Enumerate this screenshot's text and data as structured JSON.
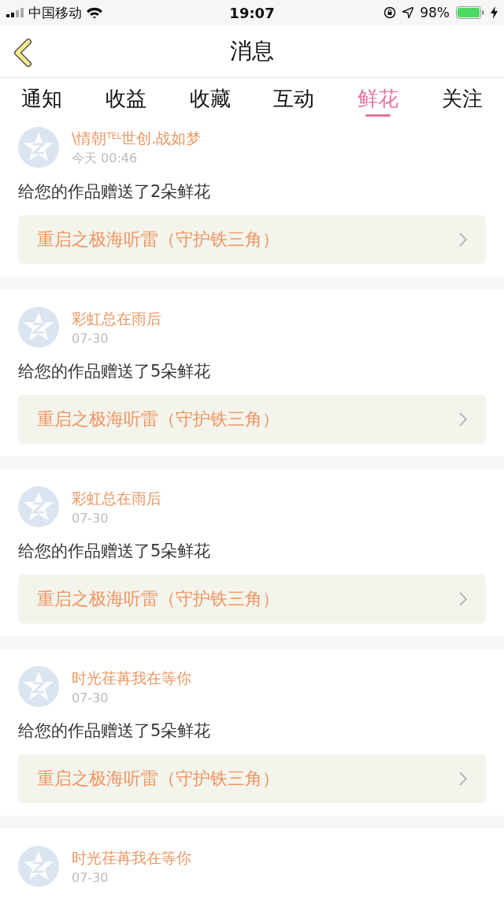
{
  "status_bar": {
    "carrier": "中国移动",
    "time": "19:07",
    "battery": "98%"
  },
  "header": {
    "title": "消息"
  },
  "tabs": [
    {
      "label": "通知",
      "selected": false
    },
    {
      "label": "收益",
      "selected": false
    },
    {
      "label": "收藏",
      "selected": false
    },
    {
      "label": "互动",
      "selected": false
    },
    {
      "label": "鲜花",
      "selected": true
    },
    {
      "label": "关注",
      "selected": false
    }
  ],
  "messages": [
    {
      "name": "\\情朝$^{TEL}$世创.战如梦",
      "time": "今天 00:46",
      "text": "给您的作品赠送了2朵鲜花",
      "work": "重启之极海听雷（守护铁三角）"
    },
    {
      "name": "彩虹总在雨后",
      "time": "07-30",
      "text": "给您的作品赠送了5朵鲜花",
      "work": "重启之极海听雷（守护铁三角）"
    },
    {
      "name": "彩虹总在雨后",
      "time": "07-30",
      "text": "给您的作品赠送了5朵鲜花",
      "work": "重启之极海听雷（守护铁三角）"
    },
    {
      "name": "时光荏苒我在等你",
      "time": "07-30",
      "text": "给您的作品赠送了5朵鲜花",
      "work": "重启之极海听雷（守护铁三角）"
    },
    {
      "name": "时光荏苒我在等你",
      "time": "07-30"
    }
  ]
}
